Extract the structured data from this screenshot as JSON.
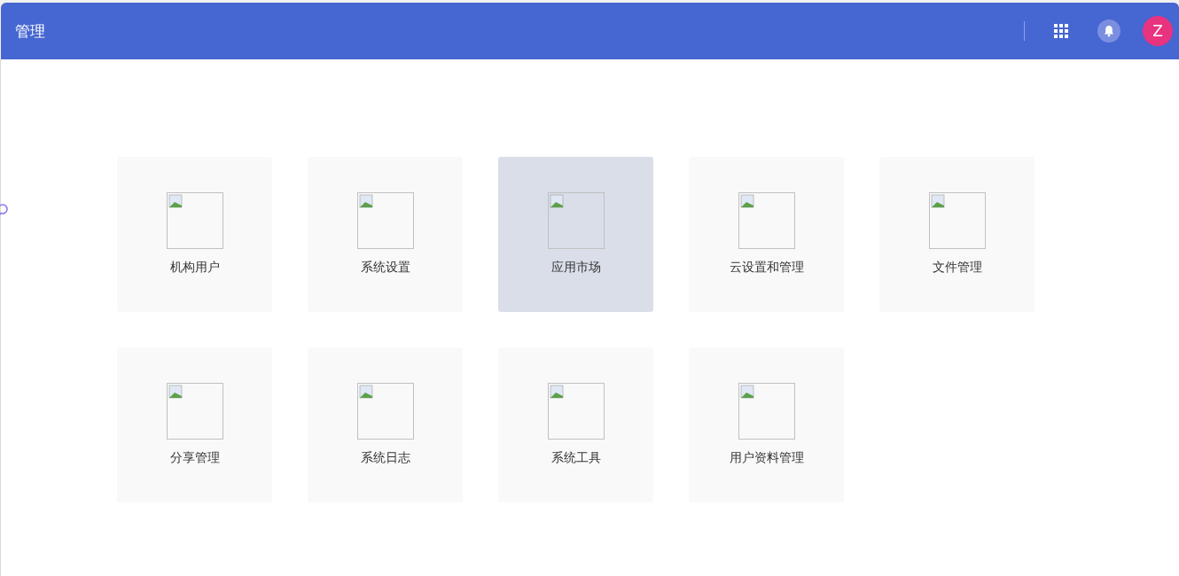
{
  "header": {
    "title": "管理",
    "avatar_letter": "Z"
  },
  "tiles": [
    {
      "label": "机构用户",
      "selected": false
    },
    {
      "label": "系统设置",
      "selected": false
    },
    {
      "label": "应用市场",
      "selected": true
    },
    {
      "label": "云设置和管理",
      "selected": false
    },
    {
      "label": "文件管理",
      "selected": false
    },
    {
      "label": "分享管理",
      "selected": false
    },
    {
      "label": "系统日志",
      "selected": false
    },
    {
      "label": "系统工具",
      "selected": false
    },
    {
      "label": "用户资料管理",
      "selected": false
    }
  ]
}
